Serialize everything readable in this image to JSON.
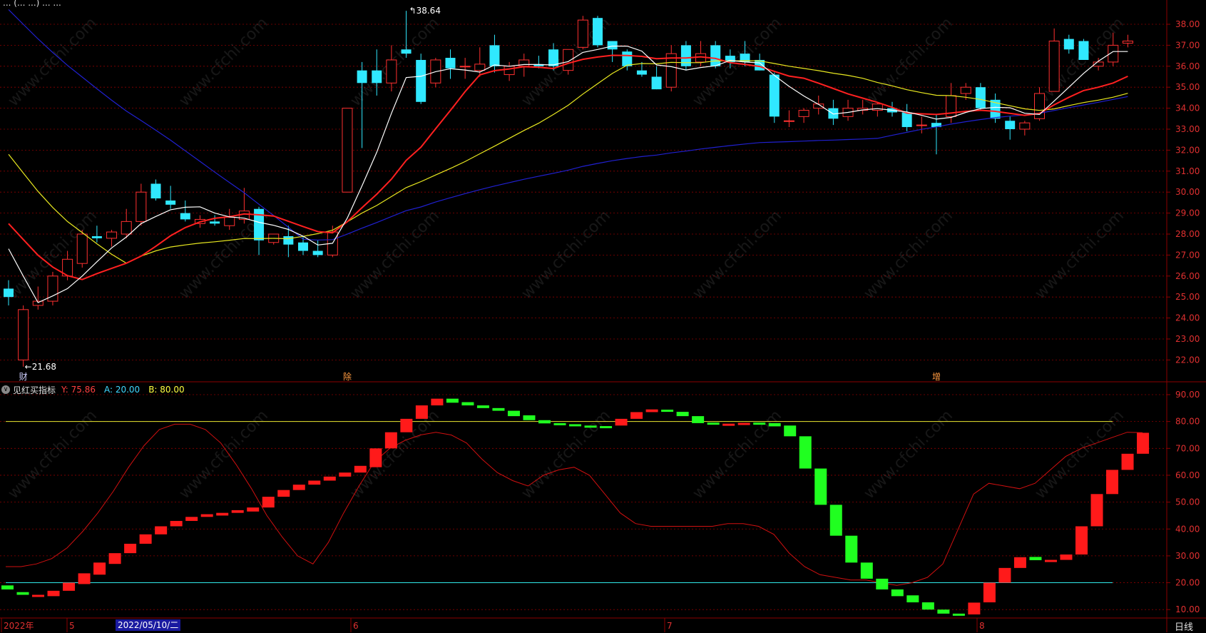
{
  "header": {
    "title_partial": "... (... ...) ... ..."
  },
  "main_panel": {
    "price_axis": [
      "38.00",
      "37.00",
      "36.00",
      "35.00",
      "34.00",
      "33.00",
      "32.00",
      "31.00",
      "30.00",
      "29.00",
      "28.00",
      "27.00",
      "26.00",
      "25.00",
      "24.00",
      "23.00",
      "22.00"
    ],
    "high_marker": "38.64",
    "low_marker": "21.68",
    "event_tags": [
      "财",
      "除",
      "增"
    ]
  },
  "indicator": {
    "name": "见红买指标",
    "y_label": "Y: 75.86",
    "a_label": "A: 20.00",
    "b_label": "B: 80.00",
    "axis": [
      "90.00",
      "80.00",
      "70.00",
      "60.00",
      "50.00",
      "40.00",
      "30.00",
      "20.00",
      "10.00"
    ]
  },
  "time_axis": {
    "labels": [
      "2022年",
      "5",
      "6",
      "7",
      "8"
    ],
    "cursor_date": "2022/05/10/二",
    "period": "日线"
  },
  "watermark": "www.cfchi.com",
  "colors": {
    "up": "#ff3030",
    "down": "#30e8ff",
    "ma5": "#ffffff",
    "ma10": "#ff2020",
    "ma20": "#e8e820",
    "ma60": "#2020d0",
    "ind_up": "#ff1a1a",
    "ind_down": "#20ff20",
    "ind_line": "#d01010",
    "line_a": "#30e8e8",
    "line_b": "#e8e830",
    "grid": "#8b0000"
  },
  "chart_data": [
    {
      "type": "candlestick",
      "ylim": [
        21.5,
        38.8
      ],
      "candles": [
        [
          25.4,
          25.8,
          24.6,
          25.0
        ],
        [
          22.0,
          24.6,
          21.68,
          24.4
        ],
        [
          24.6,
          25.5,
          24.4,
          24.8
        ],
        [
          24.8,
          26.2,
          24.6,
          26.0
        ],
        [
          26.0,
          27.2,
          25.8,
          26.8
        ],
        [
          26.6,
          28.2,
          26.4,
          28.0
        ],
        [
          27.9,
          28.4,
          27.6,
          27.8
        ],
        [
          27.8,
          28.2,
          27.4,
          28.1
        ],
        [
          28.0,
          29.2,
          27.8,
          28.6
        ],
        [
          28.6,
          30.4,
          28.4,
          30.0
        ],
        [
          30.4,
          30.6,
          29.6,
          29.7
        ],
        [
          29.6,
          30.3,
          29.2,
          29.4
        ],
        [
          29.0,
          29.6,
          28.6,
          28.7
        ],
        [
          28.5,
          28.9,
          28.3,
          28.7
        ],
        [
          28.6,
          28.9,
          28.4,
          28.5
        ],
        [
          28.4,
          29.2,
          28.2,
          28.8
        ],
        [
          28.7,
          30.2,
          28.5,
          29.1
        ],
        [
          29.2,
          29.3,
          27.0,
          27.7
        ],
        [
          27.6,
          28.0,
          27.5,
          28.0
        ],
        [
          27.9,
          28.4,
          26.9,
          27.5
        ],
        [
          27.6,
          27.9,
          27.0,
          27.2
        ],
        [
          27.2,
          27.7,
          26.9,
          27.0
        ],
        [
          27.0,
          28.4,
          26.9,
          28.1
        ],
        [
          30.0,
          34.0,
          30.0,
          34.0
        ],
        [
          35.8,
          36.2,
          32.1,
          35.2
        ],
        [
          35.8,
          36.8,
          34.6,
          35.2
        ],
        [
          35.2,
          37.0,
          34.8,
          36.3
        ],
        [
          36.8,
          38.64,
          36.4,
          36.6
        ],
        [
          36.3,
          36.6,
          34.2,
          34.3
        ],
        [
          35.2,
          36.4,
          35.0,
          36.3
        ],
        [
          36.4,
          36.8,
          35.4,
          35.9
        ],
        [
          36.0,
          36.4,
          35.4,
          36.0
        ],
        [
          35.8,
          36.9,
          35.5,
          36.1
        ],
        [
          37.0,
          37.5,
          35.7,
          36.0
        ],
        [
          35.6,
          36.2,
          35.3,
          36.0
        ],
        [
          36.0,
          36.6,
          35.5,
          36.3
        ],
        [
          36.1,
          36.5,
          35.9,
          36.0
        ],
        [
          36.8,
          37.1,
          35.8,
          36.0
        ],
        [
          35.8,
          36.8,
          35.6,
          36.8
        ],
        [
          36.9,
          38.4,
          36.8,
          38.2
        ],
        [
          38.3,
          38.4,
          36.9,
          37.0
        ],
        [
          37.2,
          37.2,
          36.2,
          36.8
        ],
        [
          36.7,
          36.8,
          35.8,
          36.0
        ],
        [
          35.8,
          36.2,
          35.5,
          35.6
        ],
        [
          35.5,
          36.0,
          34.9,
          34.9
        ],
        [
          35.0,
          37.0,
          34.8,
          36.6
        ],
        [
          37.0,
          37.2,
          35.8,
          36.0
        ],
        [
          36.2,
          37.2,
          36.0,
          36.6
        ],
        [
          37.0,
          37.2,
          35.9,
          36.0
        ],
        [
          36.5,
          36.8,
          35.9,
          36.2
        ],
        [
          36.6,
          37.2,
          36.0,
          36.2
        ],
        [
          36.3,
          36.6,
          35.8,
          35.8
        ],
        [
          35.6,
          35.7,
          33.3,
          33.6
        ],
        [
          33.4,
          33.9,
          33.1,
          33.4
        ],
        [
          33.6,
          34.0,
          33.3,
          33.9
        ],
        [
          34.0,
          34.6,
          33.7,
          34.2
        ],
        [
          34.0,
          34.4,
          33.2,
          33.5
        ],
        [
          33.6,
          34.4,
          33.4,
          34.0
        ],
        [
          33.9,
          34.4,
          33.7,
          34.0
        ],
        [
          33.9,
          34.3,
          33.6,
          34.2
        ],
        [
          34.0,
          34.3,
          33.6,
          33.8
        ],
        [
          33.8,
          34.2,
          32.9,
          33.1
        ],
        [
          33.2,
          33.6,
          32.8,
          33.2
        ],
        [
          33.3,
          33.7,
          31.8,
          33.1
        ],
        [
          33.6,
          35.2,
          33.3,
          34.6
        ],
        [
          34.7,
          35.2,
          34.4,
          35.0
        ],
        [
          35.0,
          35.2,
          33.9,
          34.0
        ],
        [
          34.4,
          34.7,
          33.3,
          33.5
        ],
        [
          33.4,
          33.6,
          32.5,
          33.0
        ],
        [
          33.0,
          33.4,
          32.7,
          33.3
        ],
        [
          33.5,
          35.0,
          33.4,
          34.7
        ],
        [
          34.8,
          37.8,
          34.8,
          37.2
        ],
        [
          37.3,
          37.5,
          36.6,
          36.8
        ],
        [
          37.2,
          37.3,
          36.3,
          36.3
        ],
        [
          36.0,
          36.4,
          35.8,
          36.2
        ],
        [
          36.2,
          37.6,
          36.0,
          37.0
        ],
        [
          37.1,
          37.5,
          36.9,
          37.2
        ]
      ],
      "ma5_ends": [
        27.3,
        36.8
      ],
      "ma10_ends": [
        28.5,
        35.6
      ],
      "ma20_ends": [
        31.8,
        34.7
      ],
      "ma60_ends": [
        38.7,
        34.3
      ]
    },
    {
      "type": "bar",
      "name": "见红买指标",
      "ylim": [
        5,
        93
      ],
      "A": 20.0,
      "B": 80.0,
      "Y": [
        26,
        26,
        27,
        29,
        33,
        39,
        46,
        54,
        63,
        71,
        77,
        79,
        79,
        77,
        72,
        64,
        55,
        45,
        37,
        30,
        27,
        35,
        46,
        56,
        65,
        70,
        73,
        75,
        76,
        75,
        72,
        66,
        61,
        58,
        56,
        60,
        62,
        63,
        60,
        53,
        46,
        42,
        41,
        41,
        41,
        41,
        41,
        42,
        42,
        41,
        38,
        31,
        26,
        23,
        22,
        21,
        21,
        20,
        19,
        20,
        22,
        27,
        40,
        53,
        57,
        56,
        55,
        57,
        62,
        67,
        70,
        72,
        74,
        76,
        75.86
      ],
      "bars": [
        [
          19,
          17.5
        ],
        [
          16.5,
          15.5
        ],
        [
          15.5,
          15.5
        ],
        [
          15,
          17
        ],
        [
          17,
          20
        ],
        [
          19.5,
          23.5
        ],
        [
          23,
          27.5
        ],
        [
          27,
          31
        ],
        [
          31,
          34.5
        ],
        [
          34.5,
          38
        ],
        [
          38,
          41
        ],
        [
          41,
          43
        ],
        [
          43,
          44.5
        ],
        [
          44.5,
          45.5
        ],
        [
          45,
          46
        ],
        [
          46,
          47
        ],
        [
          46.5,
          48
        ],
        [
          48,
          52
        ],
        [
          52,
          54.5
        ],
        [
          54.5,
          56.5
        ],
        [
          56.5,
          58
        ],
        [
          58,
          59.5
        ],
        [
          59.5,
          61
        ],
        [
          61,
          63.5
        ],
        [
          63,
          70
        ],
        [
          70,
          76
        ],
        [
          76,
          81
        ],
        [
          81,
          86
        ],
        [
          86,
          88.5
        ],
        [
          88.5,
          87
        ],
        [
          87.2,
          86
        ],
        [
          86,
          85
        ],
        [
          85,
          84
        ],
        [
          84,
          82
        ],
        [
          82.3,
          80.5
        ],
        [
          80.5,
          79.3
        ],
        [
          79.4,
          78.8
        ],
        [
          79,
          78.5
        ],
        [
          78.5,
          78
        ],
        [
          78.3,
          77.8
        ],
        [
          78.5,
          81
        ],
        [
          81,
          83.5
        ],
        [
          83.5,
          84.5
        ],
        [
          84.4,
          83.6
        ],
        [
          83.6,
          82
        ],
        [
          82,
          79.4
        ],
        [
          79.6,
          79
        ],
        [
          79,
          79.2
        ],
        [
          79.2,
          79.5
        ],
        [
          79.6,
          79.2
        ],
        [
          79.4,
          78.2
        ],
        [
          78.5,
          74.5
        ],
        [
          74.5,
          62.5
        ],
        [
          62.5,
          49
        ],
        [
          49,
          37.5
        ],
        [
          37.5,
          27.5
        ],
        [
          27.5,
          21.5
        ],
        [
          21.5,
          17.5
        ],
        [
          17.5,
          15
        ],
        [
          15.3,
          12.7
        ],
        [
          12.7,
          10
        ],
        [
          10,
          8.5
        ],
        [
          8.5,
          8.1
        ],
        [
          8.2,
          12.6
        ],
        [
          12.7,
          20
        ],
        [
          20,
          25.5
        ],
        [
          25.5,
          29.5
        ],
        [
          29.6,
          28.4
        ],
        [
          28.4,
          28.5
        ],
        [
          28.5,
          30.5
        ],
        [
          30.5,
          41
        ],
        [
          41,
          53
        ],
        [
          53,
          62
        ],
        [
          62,
          68
        ],
        [
          68,
          75.8
        ]
      ]
    }
  ]
}
